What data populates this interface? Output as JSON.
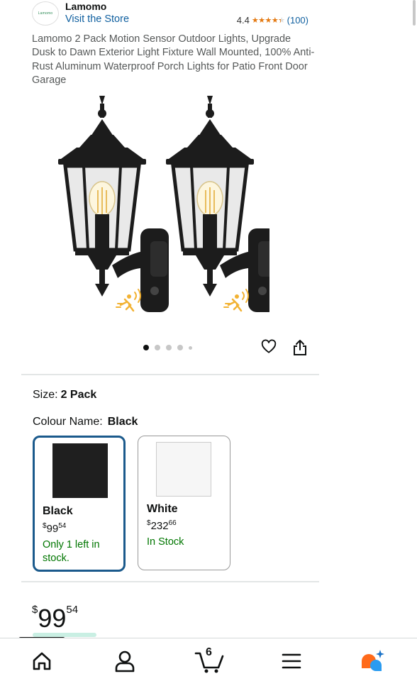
{
  "brand": {
    "name": "Lamomo",
    "logo_text": "Lamomo",
    "visit_store": "Visit the Store"
  },
  "rating": {
    "value": "4.4",
    "stars": 4.4,
    "count": "(100)"
  },
  "product": {
    "title": "Lamomo 2 Pack Motion Sensor Outdoor Lights, Upgrade Dusk to Dawn Exterior Light Fixture Wall Mounted, 100% Anti-Rust Aluminum Waterproof Porch Lights for Patio Front Door Garage",
    "image_count": 5,
    "image_active_index": 0
  },
  "size": {
    "label": "Size:",
    "value": "2 Pack"
  },
  "colour": {
    "label": "Colour Name:",
    "value": "Black",
    "options": [
      {
        "name": "Black",
        "currency": "$",
        "price_whole": "99",
        "price_fraction": "54",
        "stock": "Only 1 left in stock.",
        "swatch": "#1f1f1f",
        "selected": true
      },
      {
        "name": "White",
        "currency": "$",
        "price_whole": "232",
        "price_fraction": "66",
        "stock": "In Stock",
        "swatch": "#f6f6f6",
        "selected": false
      }
    ]
  },
  "price": {
    "currency": "$",
    "whole": "99",
    "fraction": "54"
  },
  "nav": {
    "cart_count": "6",
    "items": [
      "home-icon",
      "account-icon",
      "cart-icon",
      "menu-icon",
      "rufus-icon"
    ]
  },
  "colors": {
    "link": "#0f5f9f",
    "star": "#e47911",
    "in_stock": "#007600",
    "selected_border": "#1b5a8c"
  }
}
